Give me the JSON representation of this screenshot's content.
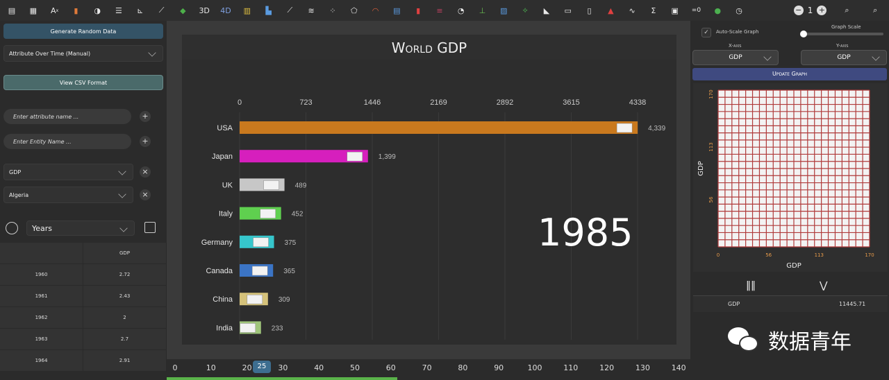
{
  "toolbar": {
    "icons": [
      "new-file",
      "table",
      "formula",
      "bar-chart",
      "pie",
      "list",
      "axis",
      "line",
      "map-color",
      "3d",
      "4d",
      "bar-multi",
      "bar-race",
      "line-trend",
      "stack",
      "bubble",
      "pentagon",
      "gauge",
      "horizontal-bar",
      "candle",
      "pyramid",
      "donut",
      "error-bar",
      "heatmap",
      "tree",
      "africa-map",
      "text-table",
      "image",
      "triangle-warning",
      "wave",
      "sigma",
      "picture",
      "fx-zero",
      "green-circle",
      "clock"
    ],
    "label_3d": "3D",
    "label_4d": "4D",
    "fx_zero": "=0",
    "minus": "−",
    "zoom_value": "1",
    "plus": "+"
  },
  "left": {
    "generate_label": "Generate Random Data",
    "mode_select": "Attribute Over Time (Manual)",
    "csv_label": "View CSV Format",
    "attr_placeholder": "Enter attribute name ...",
    "entity_placeholder": "Enter Entity Name ...",
    "add": "+",
    "attr_value": "GDP",
    "entity_value": "Algeria",
    "remove": "×",
    "time_unit": "Years",
    "table_header": [
      "",
      "GDP"
    ],
    "table_rows": [
      [
        "1960",
        "2.72"
      ],
      [
        "1961",
        "2.43"
      ],
      [
        "1962",
        "2"
      ],
      [
        "1963",
        "2.7"
      ],
      [
        "1964",
        "2.91"
      ]
    ]
  },
  "chart": {
    "title": "World GDP",
    "year": "1985",
    "bar_colors": [
      "#c9791e",
      "#d61fbd",
      "#c7c7c7",
      "#5fd04f",
      "#36c6cc",
      "#3b74c5",
      "#d5c27a",
      "#9fc57a"
    ]
  },
  "chart_data": {
    "type": "bar",
    "orientation": "horizontal",
    "title": "World GDP",
    "categories": [
      "USA",
      "Japan",
      "UK",
      "Italy",
      "Germany",
      "Canada",
      "China",
      "India"
    ],
    "values": [
      4339,
      1399,
      489,
      452,
      375,
      365,
      309,
      233
    ],
    "value_labels": [
      "4,339",
      "1,399",
      "489",
      "452",
      "375",
      "365",
      "309",
      "233"
    ],
    "xticks": [
      "0",
      "723",
      "1446",
      "2169",
      "2892",
      "3615",
      "4338"
    ],
    "xlim": [
      0,
      4338
    ],
    "annotation": "1985",
    "grid": false
  },
  "timeline": {
    "ticks": [
      "0",
      "10",
      "20",
      "30",
      "40",
      "50",
      "60",
      "70",
      "80",
      "90",
      "100",
      "110",
      "120",
      "130",
      "140"
    ],
    "current": "25",
    "progress_fraction": 0.44
  },
  "right": {
    "autoscale_label": "Auto-Scale Graph",
    "graph_scale_label": "Graph Scale",
    "xaxis_label": "X-axis",
    "yaxis_label": "Y-axis",
    "x_value": "GDP",
    "y_value": "GDP",
    "update_label": "Update Graph",
    "grid_ylabel": "GDP",
    "grid_xlabel": "GDP",
    "grid_yticks": [
      "170",
      "113",
      "56"
    ],
    "grid_xticks": [
      "0",
      "56",
      "113",
      "170"
    ],
    "stat_name": "GDP",
    "stat_value": "11445.71"
  },
  "watermark": "数据青年"
}
